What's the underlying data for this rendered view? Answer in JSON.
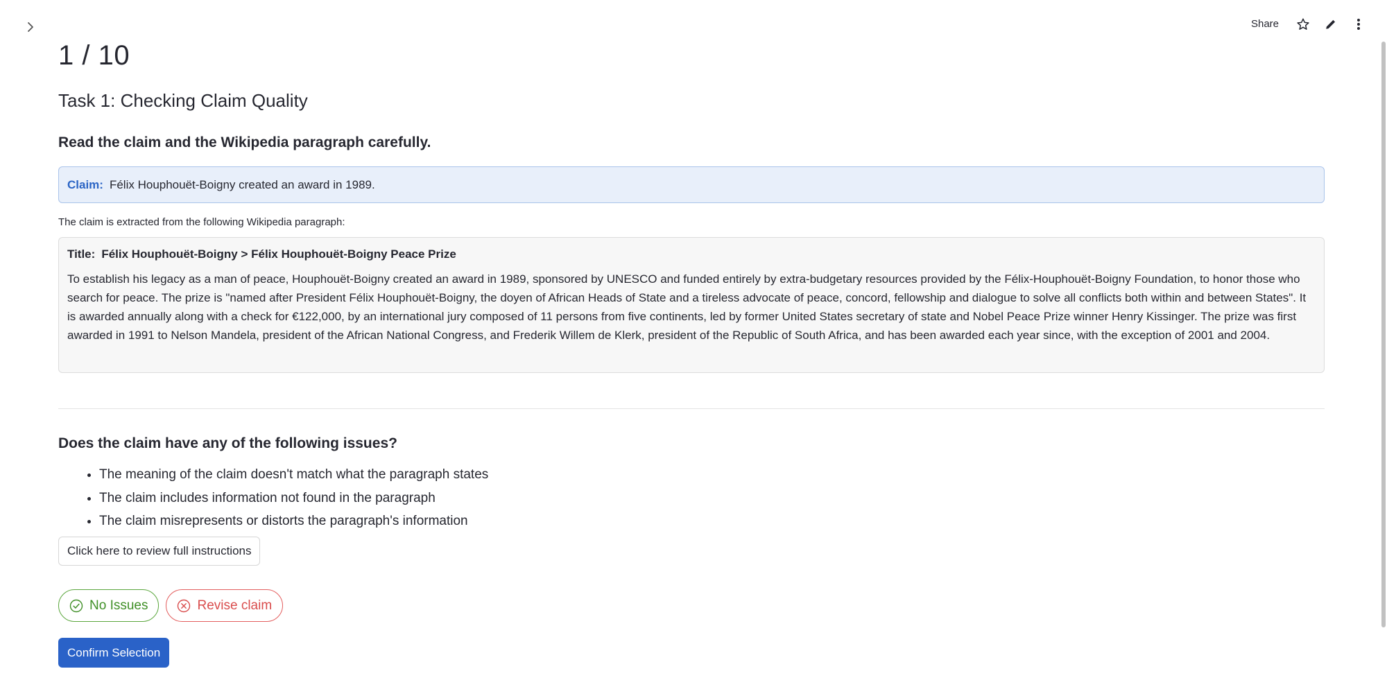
{
  "toolbar": {
    "share_label": "Share",
    "expand_icon": "chevron-right-icon",
    "star_icon": "star-icon",
    "edit_icon": "pencil-icon",
    "menu_icon": "more-vertical-icon"
  },
  "progress": {
    "counter": "1 / 10",
    "current": 1,
    "total": 10
  },
  "task": {
    "title": "Task 1: Checking Claim Quality",
    "read_heading": "Read the claim and the Wikipedia paragraph carefully."
  },
  "claim": {
    "label": "Claim:",
    "text": "Félix Houphouët-Boigny created an award in 1989."
  },
  "source": {
    "note": "The claim is extracted from the following Wikipedia paragraph:",
    "title_label": "Title:",
    "title": "Félix Houphouët-Boigny > Félix Houphouët-Boigny Peace Prize",
    "paragraph": "To establish his legacy as a man of peace, Houphouët-Boigny created an award in 1989, sponsored by UNESCO and funded entirely by extra-budgetary resources provided by the Félix-Houphouët-Boigny Foundation, to honor those who search for peace. The prize is \"named after President Félix Houphouët-Boigny, the doyen of African Heads of State and a tireless advocate of peace, concord, fellowship and dialogue to solve all conflicts both within and between States\". It is awarded annually along with a check for €122,000, by an international jury composed of 11 persons from five continents, led by former United States secretary of state and Nobel Peace Prize winner Henry Kissinger. The prize was first awarded in 1991 to Nelson Mandela, president of the African National Congress, and Frederik Willem de Klerk, president of the Republic of South Africa, and has been awarded each year since, with the exception of 2001 and 2004."
  },
  "issues": {
    "heading": "Does the claim have any of the following issues?",
    "items": [
      "The meaning of the claim doesn't match what the paragraph states",
      "The claim includes information not found in the paragraph",
      "The claim misrepresents or distorts the paragraph's information"
    ]
  },
  "actions": {
    "instructions_label": "Click here to review full instructions",
    "no_issues_label": "No Issues",
    "revise_label": "Revise claim",
    "confirm_label": "Confirm Selection"
  },
  "colors": {
    "accent_blue": "#2a62c8",
    "claim_bg": "#e8effa",
    "ok_green": "#3f8f26",
    "revise_red": "#d94c4c"
  }
}
